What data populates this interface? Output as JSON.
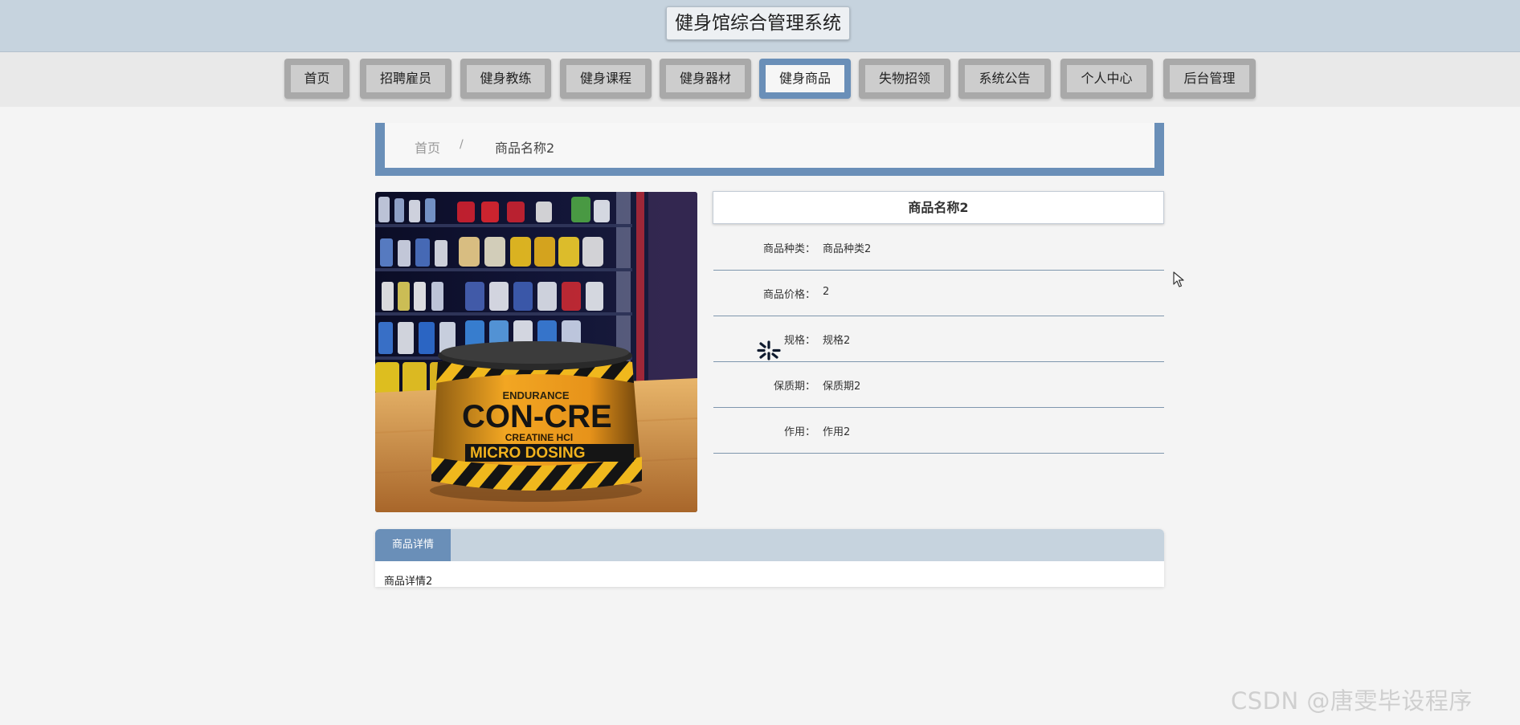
{
  "header": {
    "title": "健身馆综合管理系统"
  },
  "nav": {
    "items": [
      {
        "label": "首页"
      },
      {
        "label": "招聘雇员"
      },
      {
        "label": "健身教练"
      },
      {
        "label": "健身课程"
      },
      {
        "label": "健身器材"
      },
      {
        "label": "健身商品"
      },
      {
        "label": "失物招领"
      },
      {
        "label": "系统公告"
      },
      {
        "label": "个人中心"
      },
      {
        "label": "后台管理"
      }
    ],
    "active_label": "健身商品"
  },
  "breadcrumb": {
    "home": "首页",
    "separator": "/",
    "current": "商品名称2"
  },
  "product": {
    "image_icon": "supplement-jar-photo",
    "image_text": {
      "brand": "CON-CRE",
      "subline": "CREATINE HCl",
      "bottom": "MICRO DOSING",
      "top_band": "ENDURANCE"
    },
    "title": "商品名称2",
    "attributes": [
      {
        "label": "商品种类：",
        "value": "商品种类2"
      },
      {
        "label": "商品价格：",
        "value": "2"
      },
      {
        "label": "规格：",
        "value": "规格2"
      },
      {
        "label": "保质期：",
        "value": "保质期2"
      },
      {
        "label": "作用：",
        "value": "作用2"
      }
    ]
  },
  "detail": {
    "tab_label": "商品详情",
    "content": "商品详情2"
  },
  "overlay": {
    "loading_icon": "spinner-icon",
    "cursor_icon": "mouse-pointer-icon"
  },
  "watermark": {
    "text": "CSDN @唐雯毕设程序"
  },
  "colors": {
    "accent": "#6a8fb8",
    "header_bg": "#c6d3de",
    "nav_button": "#a9a9a9"
  }
}
